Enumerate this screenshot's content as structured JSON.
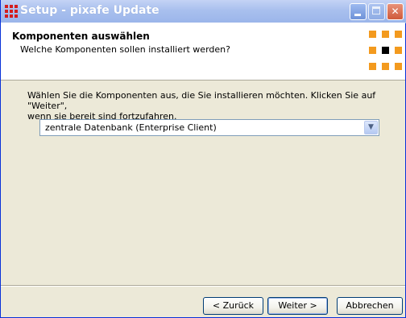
{
  "window": {
    "title": "Setup - pixafe Update"
  },
  "header": {
    "title": "Komponenten auswählen",
    "subtitle": "Welche Komponenten sollen installiert werden?"
  },
  "body": {
    "description_line1": "Wählen Sie die Komponenten aus, die Sie installieren möchten. Klicken Sie auf \"Weiter\",",
    "description_line2": "wenn sie bereit sind fortzufahren.",
    "select_value": "zentrale Datenbank (Enterprise Client)"
  },
  "buttons": {
    "back": "< Zurück",
    "next": "Weiter >",
    "cancel": "Abbrechen"
  },
  "icons": {
    "app": "setup-icon",
    "logo": "pixafe-logo",
    "minimize": "minimize-icon",
    "maximize": "maximize-icon",
    "close": "close-icon",
    "dropdown": "chevron-down-icon"
  },
  "colors": {
    "title_bar": "#a9c0ee",
    "logo_orange": "#f39a1e",
    "logo_dark": "#000000",
    "app_icon_red": "#d41c1c"
  }
}
